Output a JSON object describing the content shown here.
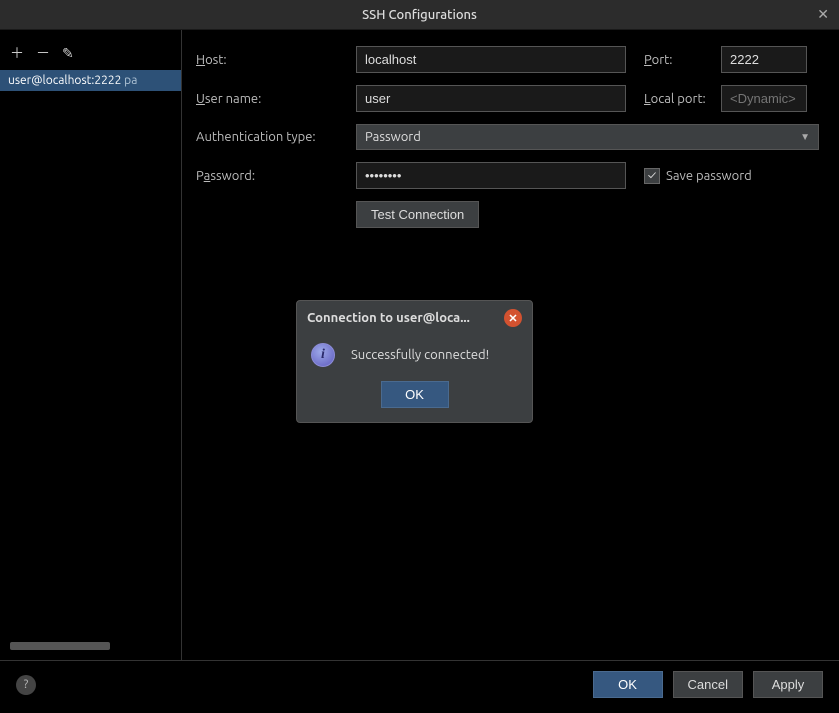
{
  "title": "SSH Configurations",
  "sidebar": {
    "items": [
      {
        "label": "user@localhost:2222",
        "suffix": " pa"
      }
    ]
  },
  "form": {
    "host_label": "Host:",
    "host_mn": "H",
    "host_value": "localhost",
    "port_label": "Port:",
    "port_mn": "P",
    "port_value": "2222",
    "user_label": "User name:",
    "user_mn": "U",
    "user_value": "user",
    "local_label": "Local port:",
    "local_mn": "L",
    "local_placeholder": "<Dynamic>",
    "auth_label": "Authentication type:",
    "auth_value": "Password",
    "password_label": "Password:",
    "password_mn": "a",
    "password_mask": "••••••••",
    "save_pw_checked": true,
    "save_pw_label": "Save password",
    "save_pw_mn": "p",
    "test_btn": "Test Connection",
    "test_mn": "C"
  },
  "modal": {
    "title": "Connection to user@loca...",
    "message": "Successfully connected!",
    "ok": "OK"
  },
  "footer": {
    "ok": "OK",
    "cancel": "Cancel",
    "apply": "Apply"
  }
}
